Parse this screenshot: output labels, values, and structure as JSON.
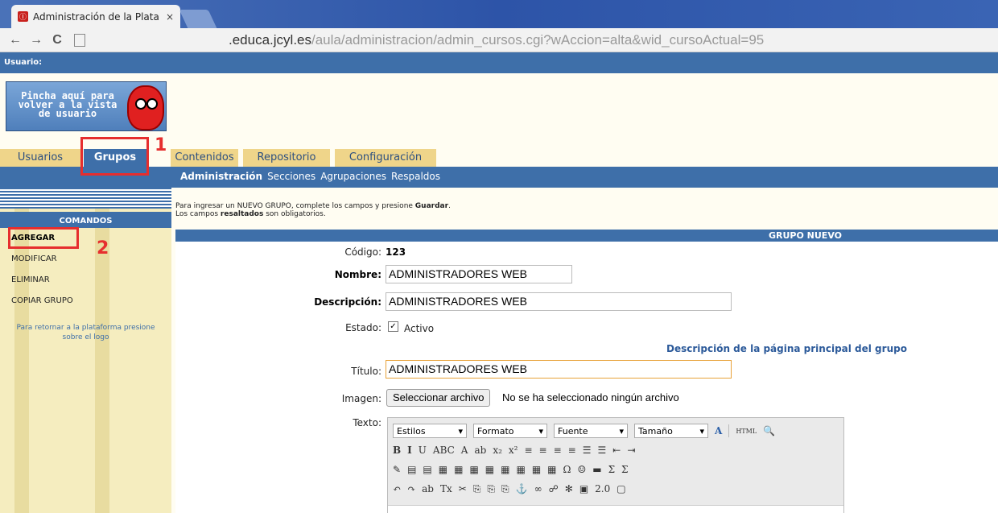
{
  "browser": {
    "tab_title": "Administración de la Plata",
    "url_prefix": ".educa.jcyl.es",
    "url_path": "/aula/administracion/admin_cursos.cgi?wAccion=alta&wid_cursoActual=95",
    "back": "←",
    "forward": "→",
    "reload": "C",
    "close": "×",
    "favicon": "Ⓘ"
  },
  "userbar": {
    "label": "Usuario:"
  },
  "back_button": {
    "label": "Pincha aquí para volver a la vista de usuario"
  },
  "main_tabs": [
    "Usuarios",
    "Grupos",
    "Contenidos",
    "Repositorio",
    "Configuración"
  ],
  "sub_nav": [
    "Administración",
    "Secciones",
    "Agrupaciones",
    "Respaldos"
  ],
  "sidebar": {
    "head": "COMANDOS",
    "commands": [
      "AGREGAR",
      "MODIFICAR",
      "ELIMINAR",
      "COPIAR GRUPO"
    ],
    "note": "Para retornar a la plataforma presione sobre el logo"
  },
  "annotations": {
    "one": "1",
    "two": "2"
  },
  "intro": {
    "line1a": "Para ingresar un NUEVO GRUPO, complete los campos y presione ",
    "line1b": "Guardar",
    "line1c": ".",
    "line2a": "Los campos ",
    "line2b": "resaltados",
    "line2c": " son obligatorios."
  },
  "form": {
    "head": "GRUPO NUEVO",
    "codigo_label": "Código:",
    "codigo_value": "123",
    "nombre_label": "Nombre:",
    "nombre_value": "ADMINISTRADORES WEB",
    "desc_label": "Descripción:",
    "desc_value": "ADMINISTRADORES WEB",
    "estado_label": "Estado:",
    "estado_check": "✓",
    "estado_value": "Activo",
    "page_desc": "Descripción de la página principal del grupo",
    "titulo_label": "Título:",
    "titulo_value": "ADMINISTRADORES WEB",
    "imagen_label": "Imagen:",
    "file_button": "Seleccionar archivo",
    "no_file": "No se ha seleccionado ningún archivo",
    "texto_label": "Texto:"
  },
  "editor": {
    "combos": [
      "Estilos",
      "Formato",
      "Fuente",
      "Tamaño"
    ],
    "row2": [
      "B",
      "I",
      "U",
      "ABC",
      "A",
      "ab",
      "x₂",
      "x²",
      "≡",
      "≡",
      "≡",
      "≡",
      "☰",
      "☰",
      "⇤",
      "⇥"
    ],
    "row3": [
      "✎",
      "▤",
      "▤",
      "▦",
      "▦",
      "▦",
      "▦",
      "▦",
      "▦",
      "▦",
      "▦",
      "Ω",
      "☺",
      "▬",
      "Σ",
      "Σ"
    ],
    "row4": [
      "↶",
      "↷",
      "ab",
      "Tx",
      "✂",
      "⎘",
      "⎘",
      "⎘",
      "⚓",
      "∞",
      "☍",
      "✻",
      "▣",
      "2.0",
      "▢"
    ]
  }
}
